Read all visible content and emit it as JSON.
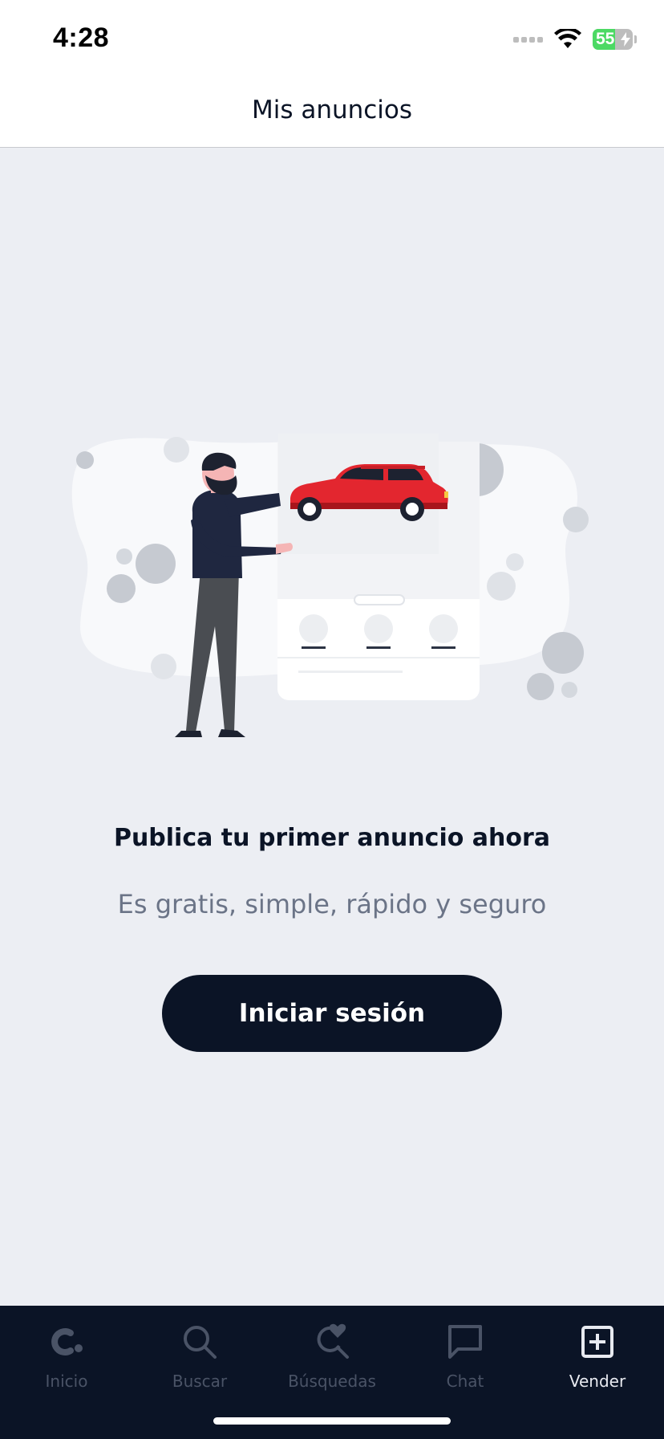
{
  "status_bar": {
    "time": "4:28",
    "battery_level": "55",
    "battery_fraction": 0.55,
    "icons": [
      "signal-dots-icon",
      "wifi-icon",
      "battery-charging-icon"
    ]
  },
  "nav": {
    "title": "Mis anuncios"
  },
  "main": {
    "headline": "Publica tu primer anuncio ahora",
    "subline": "Es gratis, simple, rápido y seguro",
    "login_button": "Iniciar sesión"
  },
  "tabs": [
    {
      "label": "Inicio",
      "icon": "logo-c-icon",
      "active": false
    },
    {
      "label": "Buscar",
      "icon": "search-icon",
      "active": false
    },
    {
      "label": "Búsquedas",
      "icon": "saved-search-heart-icon",
      "active": false
    },
    {
      "label": "Chat",
      "icon": "chat-bubble-icon",
      "active": false
    },
    {
      "label": "Vender",
      "icon": "plus-square-icon",
      "active": true
    }
  ],
  "colors": {
    "brand_dark": "#0b1426",
    "background": "#eceef3",
    "car_red": "#e3262f",
    "tab_inactive": "#4a5366",
    "tab_active": "#e8eaf0",
    "battery_green": "#4cd964"
  }
}
